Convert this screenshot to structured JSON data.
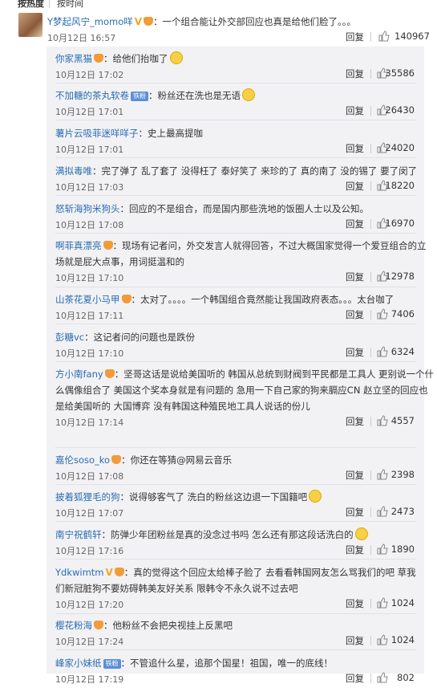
{
  "sort_bar": {
    "hot": "按热度",
    "time": "按时间"
  },
  "main_comment": {
    "username": "Y梦起风宁_momo咩",
    "text": "：一个组合能让外交部回应也真是给他们脸了。。。",
    "time": "10月12日 16:57",
    "reply_label": "回复",
    "likes": "140967"
  },
  "replies": [
    {
      "username": "你家黑猫",
      "badge": "fan",
      "text": "：给他们抬咖了",
      "emoji": true,
      "time": "10月12日 17:02",
      "likes": "35586"
    },
    {
      "username": "不加糖的茶丸软卷",
      "badge": "blue",
      "badge_text": "铁粉",
      "text": "：粉丝还在洗也是无语",
      "emoji": true,
      "time": "10月12日 17:01",
      "likes": "26430"
    },
    {
      "username": "薯片云吸菲迷咩咩子",
      "badge": "",
      "text": "：史上最高提咖",
      "emoji": false,
      "time": "10月12日 17:01",
      "likes": "24020"
    },
    {
      "username": "满拟毒唯",
      "badge": "",
      "text": "：完了弹了 乱了套了 没得枉了 泰好笑了 来珍的了 真的南了 没的锡了 要了闵了",
      "emoji": false,
      "time": "10月12日 17:03",
      "likes": "18220"
    },
    {
      "username": "怒斩海狗米狗头",
      "badge": "",
      "text": "：回应的不是组合，而是国内那些洗地的饭圈人士以及公知。",
      "emoji": false,
      "time": "10月12日 17:08",
      "likes": "16970"
    },
    {
      "username": "啊菲真漂亮",
      "badge": "heart",
      "lines": [
        "：现场有记者问，外交发言人就得回答，不过大概国家觉得一个爱豆组合的立",
        "场就是屁大点事，用词挺温和的"
      ],
      "time": "10月12日 17:10",
      "likes": "12978"
    },
    {
      "username": "山茶花夏小马甲",
      "badge": "heart",
      "text": "：太对了。。。。一个韩国组合竟然能让我国政府表态。。。太台咖了",
      "emoji": false,
      "time": "10月12日 17:11",
      "likes": "7406"
    },
    {
      "username": "彭糖vc",
      "badge": "",
      "text": "：这记者问的问题也是跌份",
      "emoji": false,
      "time": "10月12日 17:10",
      "likes": "6324"
    },
    {
      "username": "方小南fany",
      "badge": "heart",
      "lines": [
        "：坚哥这话是说给美国听的  韩国从总统到财阀到平民都是工具人 更别说一个什",
        "么偶像组合了    美国这个奖本身就是有问题的 急用一下自己家的狗来膈应CN  赵立坚的回应也",
        "是给美国听的  大国博弈 没有韩国这种殖民地工具人说话的份儿"
      ],
      "time": "10月12日 17:14",
      "likes": "4557"
    },
    {
      "username": "嘉伦soso_ko",
      "badge": "heart",
      "text": "：你还在等猜@网易云音乐",
      "emoji": false,
      "time": "10月12日 17:08",
      "likes": "2398"
    },
    {
      "username": "披着狐狸毛的狗",
      "badge": "",
      "text": "：说得够客气了 洗白的粉丝这边退一下国籍吧",
      "emoji": true,
      "time": "10月12日 17:07",
      "likes": "2473"
    },
    {
      "username": "南宁祝鹤轩",
      "badge": "",
      "text": "：防弹少年团粉丝是真的没念过书吗 怎么还有那这段话洗白的",
      "emoji": true,
      "time": "10月12日 17:16",
      "likes": "1890"
    },
    {
      "username": "Ydkwimtm",
      "badge": "vheart",
      "lines": [
        "：真的觉得这个回应太给棒子脸了  去看看韩国网友怎么骂我们的吧 草我",
        "们新冠脏狗不要妨碍韩美友好关系  限韩令不永久说不过去吧"
      ],
      "time": "10月12日 17:20",
      "likes": "1024"
    },
    {
      "username": "樱花粉海",
      "badge": "heart",
      "text": "：他粉丝不会把央视挂上反黑吧",
      "emoji": false,
      "time": "10月12日 17:24",
      "likes": "1024"
    },
    {
      "username": "峰家小妹纸",
      "badge": "blue",
      "badge_text": "铁粉",
      "text": "：不管追什么星，追那个国星！祖国，唯一的底线！",
      "emoji": false,
      "time": "10月12日 17:19",
      "likes": "802"
    }
  ],
  "reply_label": "回复",
  "colors": {
    "username": "#2b6cb0",
    "sub_bg": "#f2f2f5"
  }
}
